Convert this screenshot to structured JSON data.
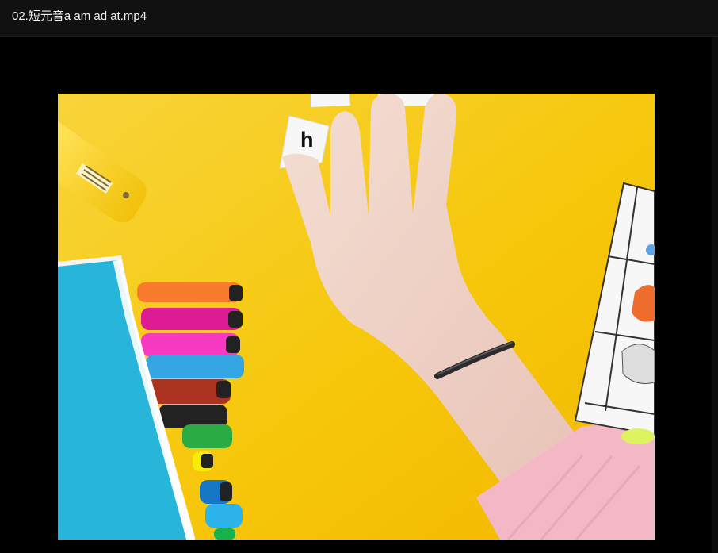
{
  "window": {
    "title": "02.短元音a am ad at.mp4"
  },
  "video": {
    "scene": "yellow tabletop with glue stick, markers, blue notebook, hand placing word cards, and worksheet",
    "colors": {
      "background": "#f8c70a",
      "book": "#27b6d9",
      "skin": "#f0d0c2",
      "sleeve": "#f3b7c6"
    }
  }
}
